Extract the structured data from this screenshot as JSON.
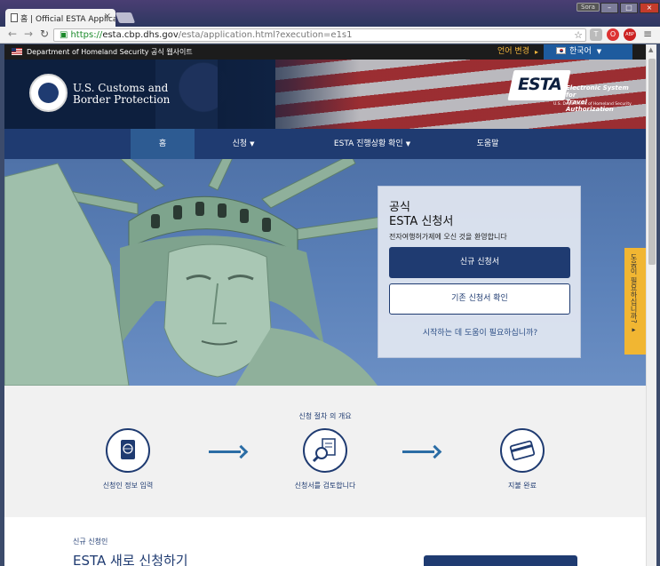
{
  "browser": {
    "tab_title": "홈 | Official ESTA Applica",
    "tab_close": "×",
    "profile": "Sora",
    "url_scheme": "https://",
    "url_host": "esta.cbp.dhs.gov",
    "url_path": "/esta/application.html?execution=e1s1",
    "ext_t": "T",
    "ext_o": "O",
    "ext_abp": "ABP",
    "menu": "≡"
  },
  "govbar": {
    "label": "Department of Homeland Security 공식 웹사이트",
    "lang_change": "언어 변경",
    "lang_arrow": "▸",
    "lang_current": "한국어"
  },
  "header": {
    "agency_line1": "U.S. Customs and",
    "agency_line2": "Border Protection",
    "esta_word": "ESTA",
    "esta_tag_line1": "Electronic System for",
    "esta_tag_line2": "Travel Authorization",
    "esta_dept": "U.S. Department of Homeland Security"
  },
  "nav": {
    "items": [
      {
        "label": "홈",
        "active": true
      },
      {
        "label": "신청",
        "dropdown": true
      },
      {
        "label": "ESTA 진행상황 확인",
        "dropdown": true
      },
      {
        "label": "도움말"
      }
    ],
    "caret": "▼"
  },
  "hero": {
    "title_line1": "공식",
    "title_line2": "ESTA 신청서",
    "welcome": "전자여행허가제에 오신 것을 환영합니다",
    "new_button": "신규 신청서",
    "existing_button": "기존 신청서 확인",
    "help_link": "시작하는 데 도움이 필요하십니까?",
    "side_help": "도움이 필요하십니까? ▸"
  },
  "process": {
    "title": "신청 절차 의 개요",
    "steps": [
      {
        "label": "신청인 정보 입력",
        "icon": "passport-icon"
      },
      {
        "label": "신청서를 검토합니다",
        "icon": "document-search-icon"
      },
      {
        "label": "지불 완료",
        "icon": "credit-card-icon"
      }
    ]
  },
  "lower": {
    "label": "신규 신청인",
    "heading": "ESTA 새로 신청하기"
  },
  "colors": {
    "navy": "#1f3b71",
    "nav_active": "#2d5b92",
    "gold": "#f1b632",
    "link_blue": "#2b6da5"
  }
}
